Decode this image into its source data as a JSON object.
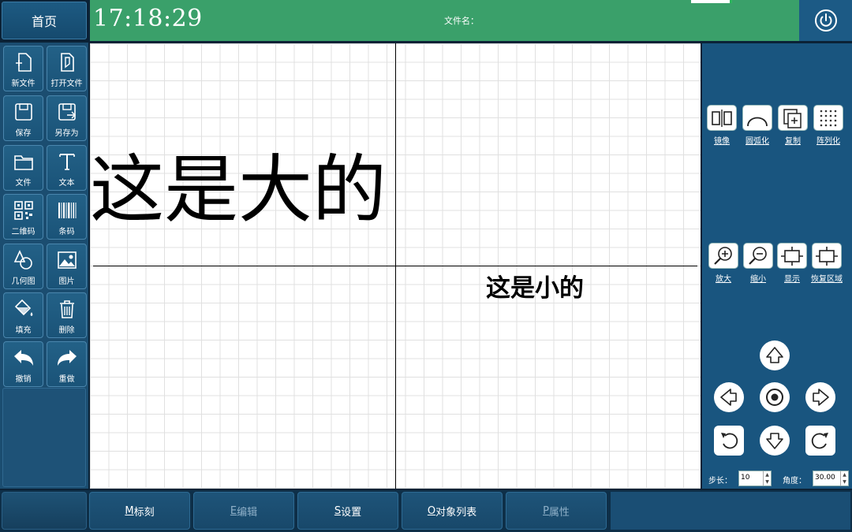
{
  "header": {
    "home_label": "首页",
    "clock": "17:18:29",
    "filename_label": "文件名："
  },
  "left_toolbar": {
    "items": [
      {
        "label": "新文件",
        "icon": "new-file-icon"
      },
      {
        "label": "打开文件",
        "icon": "open-file-icon"
      },
      {
        "label": "保存",
        "icon": "save-icon"
      },
      {
        "label": "另存为",
        "icon": "save-as-icon"
      },
      {
        "label": "文件",
        "icon": "folder-icon"
      },
      {
        "label": "文本",
        "icon": "text-icon"
      },
      {
        "label": "二维码",
        "icon": "qrcode-icon"
      },
      {
        "label": "条码",
        "icon": "barcode-icon"
      },
      {
        "label": "几何图",
        "icon": "geometry-icon"
      },
      {
        "label": "图片",
        "icon": "image-icon"
      },
      {
        "label": "填充",
        "icon": "fill-icon"
      },
      {
        "label": "删除",
        "icon": "trash-icon"
      },
      {
        "label": "撤销",
        "icon": "undo-icon"
      },
      {
        "label": "重做",
        "icon": "redo-icon"
      }
    ]
  },
  "canvas": {
    "big_text": "这是大的",
    "small_text": "这是小的"
  },
  "right_tools": {
    "row1": [
      {
        "label": "镜像",
        "icon": "mirror-icon"
      },
      {
        "label": "圆弧化",
        "icon": "arc-icon"
      },
      {
        "label": "复制",
        "icon": "copy-icon"
      },
      {
        "label": "阵列化",
        "icon": "array-icon"
      }
    ],
    "row2": [
      {
        "label": "放大",
        "icon": "zoom-in-icon"
      },
      {
        "label": "缩小",
        "icon": "zoom-out-icon"
      },
      {
        "label": "显示",
        "icon": "display-area-icon"
      },
      {
        "label": "恢复区域",
        "icon": "restore-area-icon"
      }
    ],
    "step_label": "步长：",
    "step_value": "10",
    "angle_label": "角度：",
    "angle_value": "30.00"
  },
  "bottom_tabs": [
    {
      "key": "M",
      "rest": "标刻"
    },
    {
      "key": "E",
      "rest": "编辑"
    },
    {
      "key": "S",
      "rest": "设置"
    },
    {
      "key": "O",
      "rest": "对象列表"
    },
    {
      "key": "P",
      "rest": "属性"
    }
  ],
  "colors": {
    "header_green": "#3aa06a",
    "panel_blue": "#19557f",
    "dark_bg": "#0b2236"
  }
}
